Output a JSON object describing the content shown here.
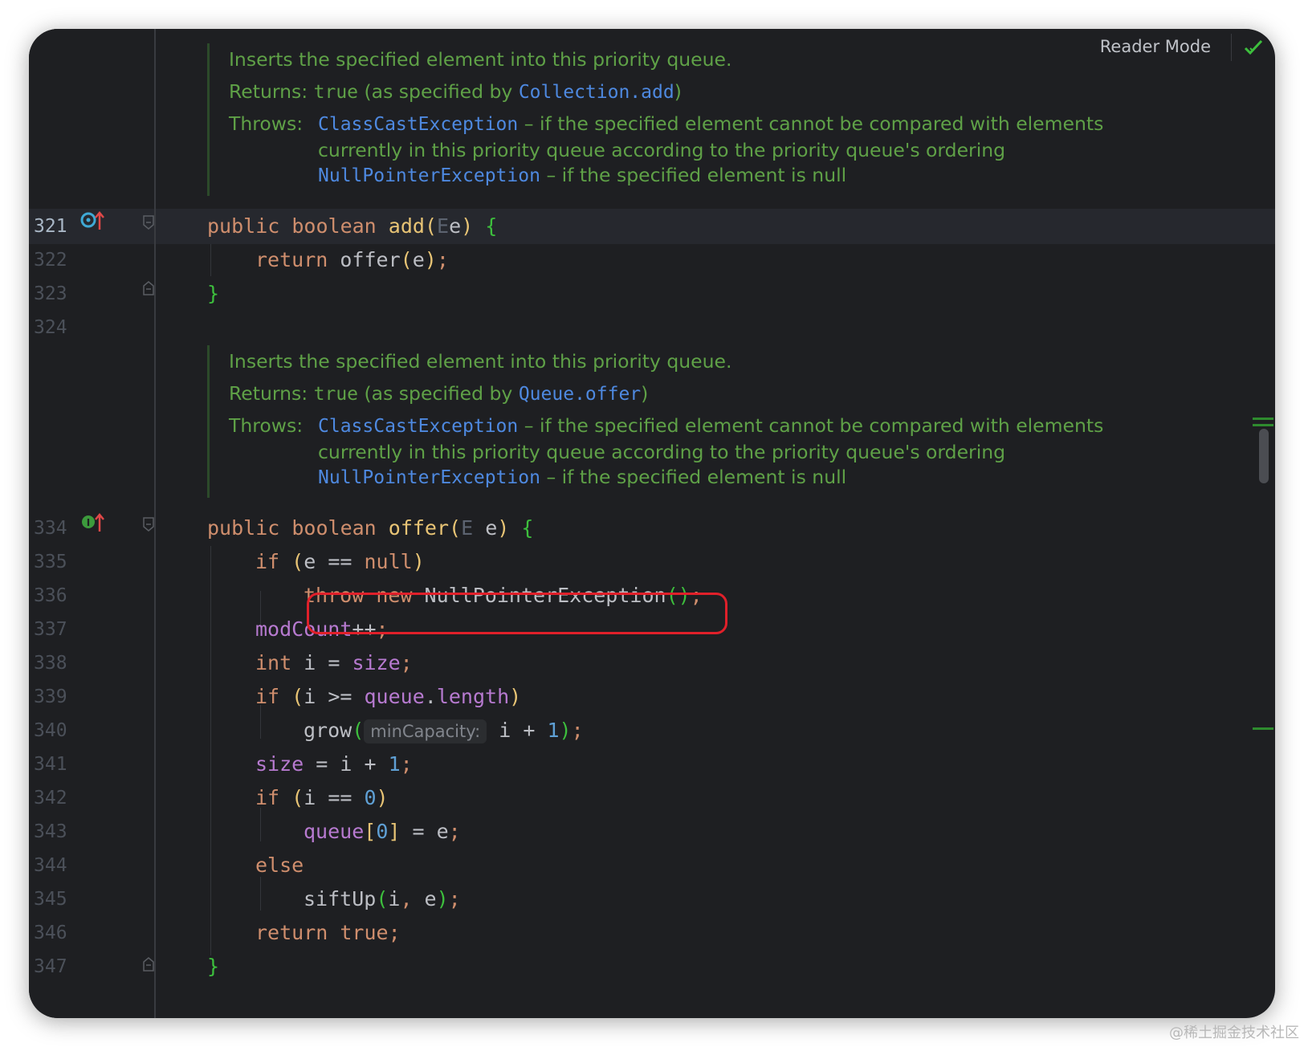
{
  "toolbar": {
    "reader_mode_label": "Reader Mode"
  },
  "docs": [
    {
      "summary": "Inserts the specified element into this priority queue.",
      "returns_label": "Returns:",
      "returns_value": "true",
      "returns_text_before": "(as specified by",
      "returns_link": "Collection.add",
      "returns_text_after": ")",
      "throws_label": "Throws:",
      "throws": [
        {
          "exception": "ClassCastException",
          "desc": "– if the specified element cannot be compared with elements",
          "desc_cont": "currently in this priority queue according to the priority queue's ordering"
        },
        {
          "exception": "NullPointerException",
          "desc": "– if the specified element is null"
        }
      ]
    },
    {
      "summary": "Inserts the specified element into this priority queue.",
      "returns_label": "Returns:",
      "returns_value": "true",
      "returns_text_before": "(as specified by",
      "returns_link": "Queue.offer",
      "returns_text_after": ")",
      "throws_label": "Throws:",
      "throws": [
        {
          "exception": "ClassCastException",
          "desc": "– if the specified element cannot be compared with elements",
          "desc_cont": "currently in this priority queue according to the priority queue's ordering"
        },
        {
          "exception": "NullPointerException",
          "desc": "– if the specified element is null"
        }
      ]
    }
  ],
  "lines": [
    {
      "num": "321",
      "tokens": [
        [
          "kw",
          "public "
        ],
        [
          "kw",
          "boolean "
        ],
        [
          "fn",
          "add"
        ],
        [
          "py",
          "("
        ],
        [
          "tp",
          "E"
        ],
        [
          "",
          "e"
        ],
        [
          "py",
          ")"
        ],
        [
          "",
          " "
        ],
        [
          "pb",
          "{"
        ]
      ]
    },
    {
      "num": "322",
      "tokens": [
        [
          "kw",
          "return "
        ],
        [
          "",
          "offer"
        ],
        [
          "py",
          "("
        ],
        [
          "",
          "e"
        ],
        [
          "py",
          ")"
        ],
        [
          "kw",
          ";"
        ]
      ]
    },
    {
      "num": "323",
      "tokens": [
        [
          "pb",
          "}"
        ]
      ]
    },
    {
      "num": "324",
      "tokens": []
    },
    {
      "num": "334",
      "tokens": [
        [
          "kw",
          "public "
        ],
        [
          "kw",
          "boolean "
        ],
        [
          "fn",
          "offer"
        ],
        [
          "py",
          "("
        ],
        [
          "tp",
          "E"
        ],
        [
          "",
          " e"
        ],
        [
          "py",
          ")"
        ],
        [
          "",
          " "
        ],
        [
          "pb",
          "{"
        ]
      ]
    },
    {
      "num": "335",
      "tokens": [
        [
          "kw",
          "if "
        ],
        [
          "py",
          "("
        ],
        [
          "",
          "e == "
        ],
        [
          "kw",
          "null"
        ],
        [
          "py",
          ")"
        ]
      ]
    },
    {
      "num": "336",
      "tokens": [
        [
          "kw",
          "throw "
        ],
        [
          "kw",
          "new "
        ],
        [
          "",
          "NullPointerException"
        ],
        [
          "pb",
          "()"
        ],
        [
          "kw",
          ";"
        ]
      ]
    },
    {
      "num": "337",
      "tokens": [
        [
          "fld",
          "modCount"
        ],
        [
          "",
          "++"
        ],
        [
          "kw",
          ";"
        ]
      ]
    },
    {
      "num": "338",
      "tokens": [
        [
          "kw",
          "int "
        ],
        [
          "",
          "i = "
        ],
        [
          "fld",
          "size"
        ],
        [
          "kw",
          ";"
        ]
      ]
    },
    {
      "num": "339",
      "tokens": [
        [
          "kw",
          "if "
        ],
        [
          "py",
          "("
        ],
        [
          "",
          "i >= "
        ],
        [
          "fld",
          "queue"
        ],
        [
          "",
          "."
        ],
        [
          "fld",
          "length"
        ],
        [
          "py",
          ")"
        ]
      ]
    },
    {
      "num": "340",
      "tokens": [
        [
          "",
          "grow"
        ],
        [
          "pb",
          "("
        ],
        [
          "hint",
          "minCapacity:"
        ],
        [
          "",
          " i + "
        ],
        [
          "num",
          "1"
        ],
        [
          "pb",
          ")"
        ],
        [
          "kw",
          ";"
        ]
      ]
    },
    {
      "num": "341",
      "tokens": [
        [
          "fld",
          "size"
        ],
        [
          "",
          " = i + "
        ],
        [
          "num",
          "1"
        ],
        [
          "kw",
          ";"
        ]
      ]
    },
    {
      "num": "342",
      "tokens": [
        [
          "kw",
          "if "
        ],
        [
          "py",
          "("
        ],
        [
          "",
          "i == "
        ],
        [
          "num",
          "0"
        ],
        [
          "py",
          ")"
        ]
      ]
    },
    {
      "num": "343",
      "tokens": [
        [
          "fld",
          "queue"
        ],
        [
          "py",
          "["
        ],
        [
          "num",
          "0"
        ],
        [
          "py",
          "]"
        ],
        [
          "",
          " = e"
        ],
        [
          "kw",
          ";"
        ]
      ]
    },
    {
      "num": "344",
      "tokens": [
        [
          "kw",
          "else"
        ]
      ]
    },
    {
      "num": "345",
      "tokens": [
        [
          "",
          "siftUp"
        ],
        [
          "pb",
          "("
        ],
        [
          "",
          "i"
        ],
        [
          "kw",
          ", "
        ],
        [
          "",
          "e"
        ],
        [
          "pb",
          ")"
        ],
        [
          "kw",
          ";"
        ]
      ]
    },
    {
      "num": "346",
      "tokens": [
        [
          "kw",
          "return "
        ],
        [
          "kw",
          "true"
        ],
        [
          "kw",
          ";"
        ]
      ]
    },
    {
      "num": "347",
      "tokens": [
        [
          "pb",
          "}"
        ]
      ]
    }
  ],
  "watermark": "@稀土掘金技术社区",
  "colors": {
    "background": "#1e1f22",
    "doc_text": "#5fa147",
    "link": "#4e89e0",
    "keyword": "#cf8e6d",
    "highlight_box": "#e0202a"
  },
  "icons": [
    "override-marker-icon",
    "implements-marker-icon",
    "fold-icon",
    "check-icon"
  ]
}
